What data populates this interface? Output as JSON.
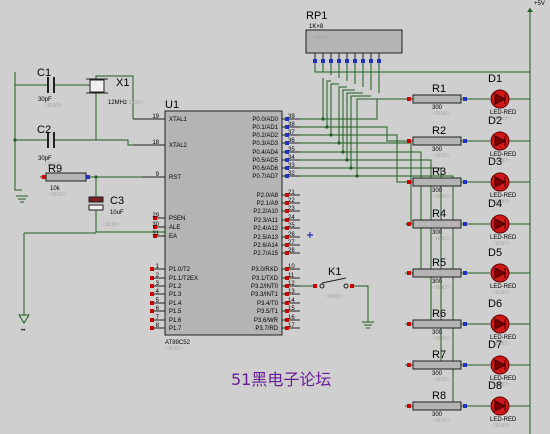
{
  "supply": "+5V",
  "placeholder": "<TEXT>",
  "watermark": "51黑电子论坛",
  "mcu": {
    "ref": "U1",
    "part": "AT89C52",
    "left_pins": [
      {
        "num": "19",
        "name": "XTAL1"
      },
      {
        "num": "18",
        "name": "XTAL2"
      },
      {
        "num": "9",
        "name": "RST"
      },
      {
        "num": "29",
        "name": "PSEN"
      },
      {
        "num": "30",
        "name": "ALE"
      },
      {
        "num": "31",
        "name": "EA"
      },
      {
        "num": "1",
        "name": "P1.0/T2"
      },
      {
        "num": "2",
        "name": "P1.1/T2EX"
      },
      {
        "num": "3",
        "name": "P1.2"
      },
      {
        "num": "4",
        "name": "P1.3"
      },
      {
        "num": "5",
        "name": "P1.4"
      },
      {
        "num": "6",
        "name": "P1.5"
      },
      {
        "num": "7",
        "name": "P1.6"
      },
      {
        "num": "8",
        "name": "P1.7"
      }
    ],
    "right_p0": [
      {
        "num": "39",
        "name": "P0.0/AD0"
      },
      {
        "num": "38",
        "name": "P0.1/AD1"
      },
      {
        "num": "37",
        "name": "P0.2/AD2"
      },
      {
        "num": "36",
        "name": "P0.3/AD3"
      },
      {
        "num": "35",
        "name": "P0.4/AD4"
      },
      {
        "num": "34",
        "name": "P0.5/AD5"
      },
      {
        "num": "33",
        "name": "P0.6/AD6"
      },
      {
        "num": "32",
        "name": "P0.7/AD7"
      }
    ],
    "right_p2": [
      {
        "num": "21",
        "name": "P2.0/A8"
      },
      {
        "num": "22",
        "name": "P2.1/A9"
      },
      {
        "num": "23",
        "name": "P2.2/A10"
      },
      {
        "num": "24",
        "name": "P2.3/A11"
      },
      {
        "num": "25",
        "name": "P2.4/A12"
      },
      {
        "num": "26",
        "name": "P2.5/A13"
      },
      {
        "num": "27",
        "name": "P2.6/A14"
      },
      {
        "num": "28",
        "name": "P2.7/A15"
      }
    ],
    "right_p3": [
      {
        "num": "10",
        "name": "P3.0/RXD"
      },
      {
        "num": "11",
        "name": "P3.1/TXD"
      },
      {
        "num": "12",
        "name": "P3.2/INT0"
      },
      {
        "num": "13",
        "name": "P3.3/INT1"
      },
      {
        "num": "14",
        "name": "P3.4/T0"
      },
      {
        "num": "15",
        "name": "P3.5/T1"
      },
      {
        "num": "16",
        "name": "P3.6/WR"
      },
      {
        "num": "17",
        "name": "P3.7/RD"
      }
    ]
  },
  "parts": {
    "c1": {
      "ref": "C1",
      "value": "30pF"
    },
    "c2": {
      "ref": "C2",
      "value": "30pF"
    },
    "c3": {
      "ref": "C3",
      "value": "10uF"
    },
    "x1": {
      "ref": "X1",
      "value": "12MHz"
    },
    "r9": {
      "ref": "R9",
      "value": "10k"
    },
    "rp1": {
      "ref": "RP1",
      "value": "1K×8"
    },
    "k1": {
      "ref": "K1"
    }
  },
  "channels": [
    {
      "r": "R1",
      "d": "D1",
      "rv": "300",
      "dv": "LED-RED"
    },
    {
      "r": "R2",
      "d": "D2",
      "rv": "300",
      "dv": "LED-RED"
    },
    {
      "r": "R3",
      "d": "D3",
      "rv": "300",
      "dv": "LED-RED"
    },
    {
      "r": "R4",
      "d": "D4",
      "rv": "300",
      "dv": "LED-RED"
    },
    {
      "r": "R5",
      "d": "D5",
      "rv": "300",
      "dv": "LED-RED"
    },
    {
      "r": "R6",
      "d": "D6",
      "rv": "300",
      "dv": "LED-RED"
    },
    {
      "r": "R7",
      "d": "D7",
      "rv": "300",
      "dv": "LED-RED"
    },
    {
      "r": "R8",
      "d": "D8",
      "rv": "300",
      "dv": "LED-RED"
    }
  ],
  "colors": {
    "background": "#cfcfcf",
    "wire": "#1e5e1e",
    "body": "#b4b4b4",
    "led": "#d01818",
    "pin_red": "#cc0000",
    "pin_blue": "#2030c0"
  }
}
